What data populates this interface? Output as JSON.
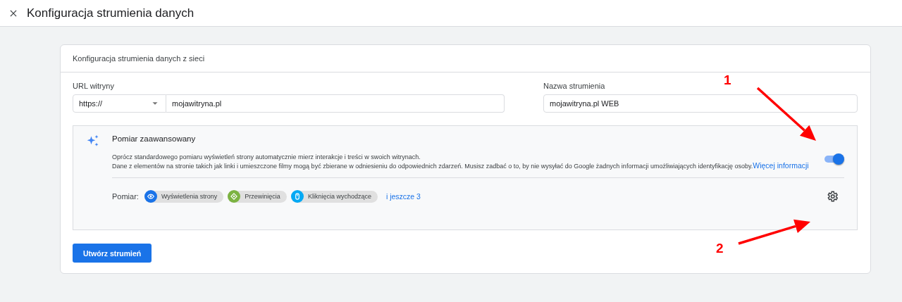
{
  "header": {
    "title": "Konfiguracja strumienia danych"
  },
  "card": {
    "title": "Konfiguracja strumienia danych z sieci",
    "url_field": {
      "label": "URL witryny",
      "protocol": "https://",
      "value": "mojawitryna.pl"
    },
    "name_field": {
      "label": "Nazwa strumienia",
      "value": "mojawitryna.pl WEB"
    },
    "enhanced": {
      "title": "Pomiar zaawansowany",
      "on": true,
      "description_1": "Oprócz standardowego pomiaru wyświetleń strony automatycznie mierz interakcje i treści w swoich witrynach.",
      "description_2": "Dane z elementów na stronie takich jak linki i umieszczone filmy mogą być zbierane w odniesieniu do odpowiednich zdarzeń. Musisz zadbać o to, by nie wysyłać do Google żadnych informacji umożliwiających identyfikację osoby.",
      "link": "Więcej informacji",
      "measure_label": "Pomiar:",
      "chips": [
        {
          "label": "Wyświetlenia strony",
          "color": "#1a73e8"
        },
        {
          "label": "Przewinięcia",
          "color": "#7cb342"
        },
        {
          "label": "Kliknięcia wychodzące",
          "color": "#03a9f4"
        }
      ],
      "more": "i jeszcze 3"
    },
    "button": "Utwórz strumień"
  },
  "annotations": [
    {
      "label": "1"
    },
    {
      "label": "2"
    }
  ]
}
